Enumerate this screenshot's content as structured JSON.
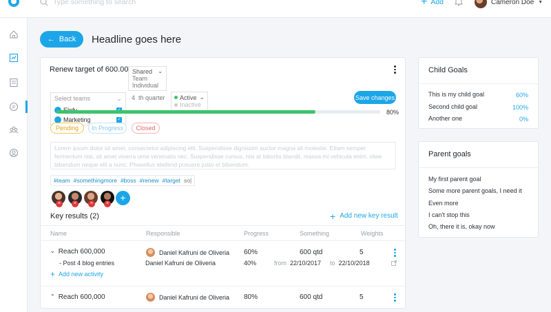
{
  "topbar": {
    "search_placeholder": "Type something to search",
    "add_label": "Add",
    "user_name": "Cameron Doe"
  },
  "page": {
    "back_label": "Back",
    "headline": "Headline goes here"
  },
  "goal": {
    "title": "Renew target of 600.00",
    "visibility": {
      "selected": "Shared",
      "options": [
        "Team",
        "Individual"
      ]
    },
    "teams": {
      "placeholder": "Select teams",
      "items": [
        "Elofy",
        "Marketing"
      ]
    },
    "quarter": {
      "prefix": "4",
      "label": "th quarter"
    },
    "status": {
      "selected": "Active",
      "other": "Inactive"
    },
    "save_label": "Save changes",
    "progress_value": 0.8,
    "progress_label": "80%",
    "pills": [
      "Pending",
      "In Progress",
      "Closed"
    ],
    "description": "Lorem ipsum dolor sit amet, consectetur adipiscing elit. Suspendisse dignissim auctor magna sit molestie. Etiam semper fermentum nisi, sit amet viverra urna venenatis nec. Suspendisse cursus, nisi at lobortis blandit, massa mi vehicula enim, vitae bibendum neque elit a nunc. Phasellus eleifend posuere justo et bibendum.",
    "tags": [
      "#team",
      "#somethingmore",
      "#boss",
      "#renew",
      "#target",
      "so|"
    ]
  },
  "key_results": {
    "title": "Key results (2)",
    "add_label": "Add new key result",
    "columns": [
      "Name",
      "Responsible",
      "Progress",
      "Something",
      "Weights"
    ],
    "rows": [
      {
        "name": "Reach 600,000",
        "responsible": "Daniel Kafruni de Oliveria",
        "progress": "60%",
        "something": "600 qtd",
        "weight": "5"
      },
      {
        "name": "Reach 600,000",
        "responsible": "Daniel Kafruni de Oliveria",
        "progress": "80%",
        "something": "600 qtd",
        "weight": "5"
      }
    ],
    "sub_item": {
      "name": "- Post 4 blog entries",
      "responsible": "Daniel Kafruni de Oliveria",
      "progress": "40%",
      "from_label": "from",
      "from_date": "22/10/2017",
      "to_label": "to",
      "to_date": "22/10/2018"
    },
    "add_activity_label": "Add new activity"
  },
  "child_goals": {
    "title": "Child Goals",
    "items": [
      {
        "label": "This is my child goal",
        "value": "60%"
      },
      {
        "label": "Second child goal",
        "value": "100%"
      },
      {
        "label": "Another one",
        "value": "0%"
      }
    ]
  },
  "parent_goals": {
    "title": "Parent goals",
    "items": [
      "My first parent goal",
      "Some more parent goals, I need it",
      "Even more",
      "I can't stop this",
      "Oh, there it is, okay now"
    ]
  },
  "colors": {
    "accent": "#1ca6e8",
    "progress": "#3cc46b",
    "danger": "#e0383b"
  }
}
